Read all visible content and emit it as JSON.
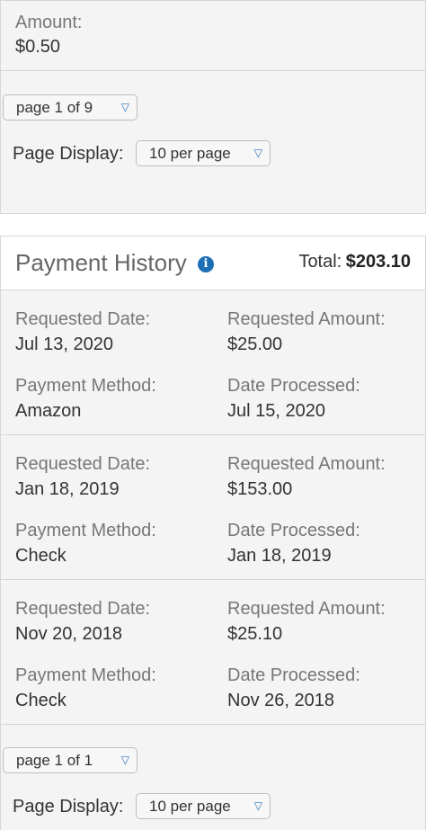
{
  "amount": {
    "label": "Amount:",
    "value": "$0.50"
  },
  "top_pager": {
    "page_select": "page 1 of 9",
    "display_label": "Page Display:",
    "display_select": "10 per page"
  },
  "payment_history": {
    "title": "Payment History",
    "info_icon": "info-icon",
    "total_label": "Total:",
    "total_value": "$203.10",
    "records": [
      {
        "requested_date_label": "Requested Date:",
        "requested_date": "Jul 13, 2020",
        "requested_amount_label": "Requested Amount:",
        "requested_amount": "$25.00",
        "payment_method_label": "Payment Method:",
        "payment_method": "Amazon",
        "date_processed_label": "Date Processed:",
        "date_processed": "Jul 15, 2020"
      },
      {
        "requested_date_label": "Requested Date:",
        "requested_date": "Jan 18, 2019",
        "requested_amount_label": "Requested Amount:",
        "requested_amount": "$153.00",
        "payment_method_label": "Payment Method:",
        "payment_method": "Check",
        "date_processed_label": "Date Processed:",
        "date_processed": "Jan 18, 2019"
      },
      {
        "requested_date_label": "Requested Date:",
        "requested_date": "Nov 20, 2018",
        "requested_amount_label": "Requested Amount:",
        "requested_amount": "$25.10",
        "payment_method_label": "Payment Method:",
        "payment_method": "Check",
        "date_processed_label": "Date Processed:",
        "date_processed": "Nov 26, 2018"
      }
    ]
  },
  "bottom_pager": {
    "page_select": "page 1 of 1",
    "display_label": "Page Display:",
    "display_select": "10 per page"
  },
  "colors": {
    "accent": "#1f6fb5",
    "panel_bg": "#f4f4f4",
    "border": "#d6d6d6"
  }
}
